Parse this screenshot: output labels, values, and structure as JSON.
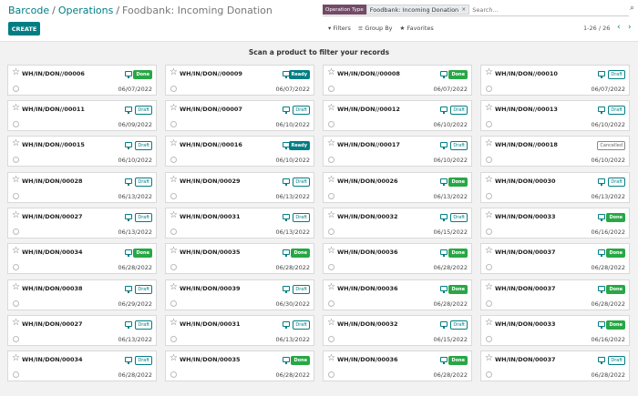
{
  "header": {
    "breadcrumb": [
      "Barcode",
      "Operations",
      "Foodbank: Incoming Donation"
    ],
    "create_label": "CREATE",
    "facet_label": "Operation Type",
    "facet_value": "Foodbank: Incoming Donation",
    "facet_remove": "×",
    "search_placeholder": "Search...",
    "filters_label": "Filters",
    "groupby_label": "Group By",
    "favorites_label": "Favorites",
    "pager": "1-26 / 26",
    "scan_message": "Scan a product to filter your records"
  },
  "cards": [
    {
      "ref": "WH/IN/DON//00006",
      "status": "Done",
      "date": "06/07/2022"
    },
    {
      "ref": "WH/IN/DON//00009",
      "status": "Ready",
      "date": "06/07/2022"
    },
    {
      "ref": "WH/IN/DON//00008",
      "status": "Done",
      "date": "06/07/2022"
    },
    {
      "ref": "WH/IN/DON//00010",
      "status": "Draft",
      "date": "06/07/2022"
    },
    {
      "ref": "WH/IN/DON//00011",
      "status": "Draft",
      "date": "06/09/2022"
    },
    {
      "ref": "WH/IN/DON//00007",
      "status": "Draft",
      "date": "06/10/2022"
    },
    {
      "ref": "WH/IN/DON//00012",
      "status": "Draft",
      "date": "06/10/2022"
    },
    {
      "ref": "WH/IN/DON//00013",
      "status": "Draft",
      "date": "06/10/2022"
    },
    {
      "ref": "WH/IN/DON//00015",
      "status": "Draft",
      "date": "06/10/2022"
    },
    {
      "ref": "WH/IN/DON//00016",
      "status": "Ready",
      "date": "06/10/2022"
    },
    {
      "ref": "WH/IN/DON//00017",
      "status": "Draft",
      "date": "06/10/2022"
    },
    {
      "ref": "WH/IN/DON//00018",
      "status": "Cancelled",
      "date": "06/10/2022"
    },
    {
      "ref": "WH/IN/DON/00028",
      "status": "Draft",
      "date": "06/13/2022"
    },
    {
      "ref": "WH/IN/DON/00029",
      "status": "Draft",
      "date": "06/13/2022"
    },
    {
      "ref": "WH/IN/DON/00026",
      "status": "Done",
      "date": "06/13/2022"
    },
    {
      "ref": "WH/IN/DON/00030",
      "status": "Draft",
      "date": "06/13/2022"
    },
    {
      "ref": "WH/IN/DON/00027",
      "status": "Draft",
      "date": "06/13/2022"
    },
    {
      "ref": "WH/IN/DON/00031",
      "status": "Draft",
      "date": "06/13/2022"
    },
    {
      "ref": "WH/IN/DON/00032",
      "status": "Draft",
      "date": "06/15/2022"
    },
    {
      "ref": "WH/IN/DON/00033",
      "status": "Done",
      "date": "06/16/2022"
    },
    {
      "ref": "WH/IN/DON/00034",
      "status": "Done",
      "date": "06/28/2022"
    },
    {
      "ref": "WH/IN/DON/00035",
      "status": "Done",
      "date": "06/28/2022"
    },
    {
      "ref": "WH/IN/DON/00036",
      "status": "Done",
      "date": "06/28/2022"
    },
    {
      "ref": "WH/IN/DON/00037",
      "status": "Done",
      "date": "06/28/2022"
    },
    {
      "ref": "WH/IN/DON/00038",
      "status": "Draft",
      "date": "06/29/2022"
    },
    {
      "ref": "WH/IN/DON/00039",
      "status": "Draft",
      "date": "06/30/2022"
    },
    {
      "ref": "WH/IN/DON/00036",
      "status": "Done",
      "date": "06/28/2022"
    },
    {
      "ref": "WH/IN/DON/00037",
      "status": "Done",
      "date": "06/28/2022"
    },
    {
      "ref": "WH/IN/DON/00027",
      "status": "Draft",
      "date": "06/13/2022"
    },
    {
      "ref": "WH/IN/DON/00031",
      "status": "Draft",
      "date": "06/13/2022"
    },
    {
      "ref": "WH/IN/DON/00032",
      "status": "Draft",
      "date": "06/15/2022"
    },
    {
      "ref": "WH/IN/DON/00033",
      "status": "Done",
      "date": "06/16/2022"
    },
    {
      "ref": "WH/IN/DON/00034",
      "status": "Draft",
      "date": "06/28/2022"
    },
    {
      "ref": "WH/IN/DON/00035",
      "status": "Done",
      "date": "06/28/2022"
    },
    {
      "ref": "WH/IN/DON/00036",
      "status": "Done",
      "date": "06/28/2022"
    },
    {
      "ref": "WH/IN/DON/00037",
      "status": "Draft",
      "date": "06/28/2022"
    }
  ],
  "colors": {
    "brand": "#017e84",
    "facet": "#714b67",
    "done": "#28a745"
  }
}
